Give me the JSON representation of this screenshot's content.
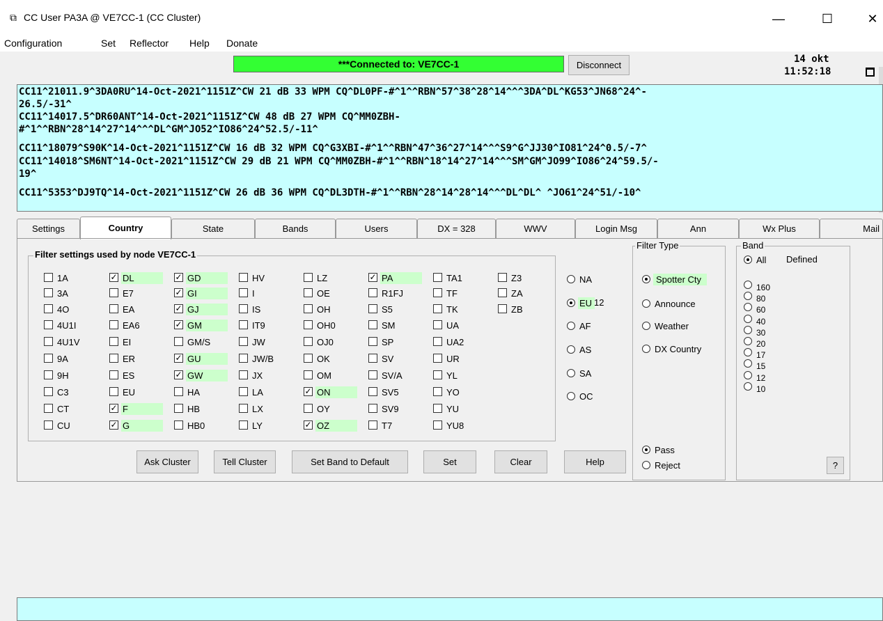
{
  "window": {
    "title": "CC User PA3A @ VE7CC-1  (CC Cluster)",
    "icon": "app-window-icon",
    "minimize": "—",
    "maximize": "☐",
    "close": "✕"
  },
  "menu": [
    "Configuration",
    "Set",
    "Reflector",
    "Help",
    "Donate"
  ],
  "status": {
    "connected": "***Connected to: VE7CC-1",
    "connected_color": "#33ff33",
    "disconnect_label": "Disconnect",
    "date": "14 okt",
    "time": "11:52:18"
  },
  "spots": [
    "CC11^21011.9^3DA0RU^14-Oct-2021^1151Z^CW 21 dB 33 WPM CQ^DL0PF-#^1^^RBN^57^38^28^14^^^3DA^DL^KG53^JN68^24^-",
    "26.5/-31^",
    "CC11^14017.5^DR60ANT^14-Oct-2021^1151Z^CW 48 dB 27 WPM CQ^MM0ZBH-",
    "#^1^^RBN^28^14^27^14^^^DL^GM^JO52^IO86^24^52.5/-11^",
    "CC11^18079^S90K^14-Oct-2021^1151Z^CW 16 dB 32 WPM CQ^G3XBI-#^1^^RBN^47^36^27^14^^^S9^G^JJ30^IO81^24^0.5/-7^",
    "CC11^14018^SM6NT^14-Oct-2021^1151Z^CW 29 dB 21 WPM CQ^MM0ZBH-#^1^^RBN^18^14^27^14^^^SM^GM^JO99^IO86^24^59.5/-",
    "19^",
    "CC11^5353^DJ9TQ^14-Oct-2021^1151Z^CW 26 dB 36 WPM CQ^DL3DTH-#^1^^RBN^28^14^28^14^^^DL^DL^    ^JO61^24^51/-10^"
  ],
  "tabs": [
    "Settings",
    "Country",
    "State",
    "Bands",
    "Users",
    "DX = 328",
    "WWV",
    "Login Msg",
    "Ann",
    "Wx Plus",
    "Mail"
  ],
  "active_tab": "Country",
  "filter": {
    "group_label": "Filter settings used by node VE7CC-1",
    "columns": [
      [
        {
          "l": "1A",
          "c": false
        },
        {
          "l": "3A",
          "c": false
        },
        {
          "l": "4O",
          "c": false
        },
        {
          "l": "4U1I",
          "c": false
        },
        {
          "l": "4U1V",
          "c": false
        },
        {
          "l": "9A",
          "c": false
        },
        {
          "l": "9H",
          "c": false
        },
        {
          "l": "C3",
          "c": false
        },
        {
          "l": "CT",
          "c": false
        },
        {
          "l": "CU",
          "c": false
        }
      ],
      [
        {
          "l": "DL",
          "c": true
        },
        {
          "l": "E7",
          "c": false
        },
        {
          "l": "EA",
          "c": false
        },
        {
          "l": "EA6",
          "c": false
        },
        {
          "l": "EI",
          "c": false
        },
        {
          "l": "ER",
          "c": false
        },
        {
          "l": "ES",
          "c": false
        },
        {
          "l": "EU",
          "c": false
        },
        {
          "l": "F",
          "c": true
        },
        {
          "l": "G",
          "c": true
        }
      ],
      [
        {
          "l": "GD",
          "c": true
        },
        {
          "l": "GI",
          "c": true
        },
        {
          "l": "GJ",
          "c": true
        },
        {
          "l": "GM",
          "c": true
        },
        {
          "l": "GM/S",
          "c": false
        },
        {
          "l": "GU",
          "c": true
        },
        {
          "l": "GW",
          "c": true
        },
        {
          "l": "HA",
          "c": false
        },
        {
          "l": "HB",
          "c": false
        },
        {
          "l": "HB0",
          "c": false
        }
      ],
      [
        {
          "l": "HV",
          "c": false
        },
        {
          "l": "I",
          "c": false
        },
        {
          "l": "IS",
          "c": false
        },
        {
          "l": "IT9",
          "c": false
        },
        {
          "l": "JW",
          "c": false
        },
        {
          "l": "JW/B",
          "c": false
        },
        {
          "l": "JX",
          "c": false
        },
        {
          "l": "LA",
          "c": false
        },
        {
          "l": "LX",
          "c": false
        },
        {
          "l": "LY",
          "c": false
        }
      ],
      [
        {
          "l": "LZ",
          "c": false
        },
        {
          "l": "OE",
          "c": false
        },
        {
          "l": "OH",
          "c": false
        },
        {
          "l": "OH0",
          "c": false
        },
        {
          "l": "OJ0",
          "c": false
        },
        {
          "l": "OK",
          "c": false
        },
        {
          "l": "OM",
          "c": false
        },
        {
          "l": "ON",
          "c": true
        },
        {
          "l": "OY",
          "c": false
        },
        {
          "l": "OZ",
          "c": true
        }
      ],
      [
        {
          "l": "PA",
          "c": true
        },
        {
          "l": "R1FJ",
          "c": false
        },
        {
          "l": "S5",
          "c": false
        },
        {
          "l": "SM",
          "c": false
        },
        {
          "l": "SP",
          "c": false
        },
        {
          "l": "SV",
          "c": false
        },
        {
          "l": "SV/A",
          "c": false
        },
        {
          "l": "SV5",
          "c": false
        },
        {
          "l": "SV9",
          "c": false
        },
        {
          "l": "T7",
          "c": false
        }
      ],
      [
        {
          "l": "TA1",
          "c": false
        },
        {
          "l": "TF",
          "c": false
        },
        {
          "l": "TK",
          "c": false
        },
        {
          "l": "UA",
          "c": false
        },
        {
          "l": "UA2",
          "c": false
        },
        {
          "l": "UR",
          "c": false
        },
        {
          "l": "YL",
          "c": false
        },
        {
          "l": "YO",
          "c": false
        },
        {
          "l": "YU",
          "c": false
        },
        {
          "l": "YU8",
          "c": false
        }
      ],
      [
        {
          "l": "Z3",
          "c": false
        },
        {
          "l": "ZA",
          "c": false
        },
        {
          "l": "ZB",
          "c": false
        }
      ]
    ],
    "continents": [
      {
        "l": "NA",
        "on": false
      },
      {
        "l": "EU",
        "on": true
      },
      {
        "l": "AF",
        "on": false
      },
      {
        "l": "AS",
        "on": false
      },
      {
        "l": "SA",
        "on": false
      },
      {
        "l": "OC",
        "on": false
      }
    ],
    "eu_count": "12",
    "buttons": [
      "Ask Cluster",
      "Tell Cluster",
      "Set Band to Default",
      "Set",
      "Clear",
      "Help"
    ]
  },
  "filter_type": {
    "label": "Filter Type",
    "options": [
      {
        "l": "Spotter Cty",
        "on": true
      },
      {
        "l": "Announce",
        "on": false
      },
      {
        "l": "Weather",
        "on": false
      },
      {
        "l": "DX Country",
        "on": false
      }
    ],
    "pass": "Pass",
    "reject": "Reject",
    "pass_selected": true
  },
  "band": {
    "label": "Band",
    "all": "All",
    "defined": "Defined",
    "bands": [
      "160",
      "80",
      "60",
      "40",
      "30",
      "20",
      "17",
      "15",
      "12",
      "10"
    ],
    "help_btn": "?"
  },
  "highlight_color": "#ccffcc",
  "spot_bg": "#c7ffff"
}
